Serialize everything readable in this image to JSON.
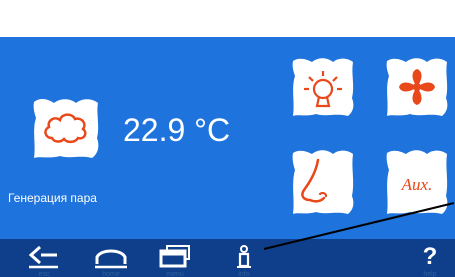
{
  "screen": {
    "temperature": "22.9 °C",
    "caption": "Генерация пара",
    "accent_color": "#e8481a",
    "background_color": "#1e73dc",
    "nav_color": "#0f3f8a"
  },
  "tiles": [
    {
      "name": "steam-tile",
      "icon": "cloud-icon"
    },
    {
      "name": "light-tile",
      "icon": "lightbulb-icon"
    },
    {
      "name": "fan-tile",
      "icon": "fan-icon"
    },
    {
      "name": "aroma-tile",
      "icon": "nose-icon"
    },
    {
      "name": "aux-tile",
      "icon": "aux-icon",
      "text": "Aux."
    }
  ],
  "nav": {
    "esc": "esc",
    "home": "home",
    "menu": "menu",
    "info": "info",
    "help": "help",
    "help_symbol": "?"
  }
}
